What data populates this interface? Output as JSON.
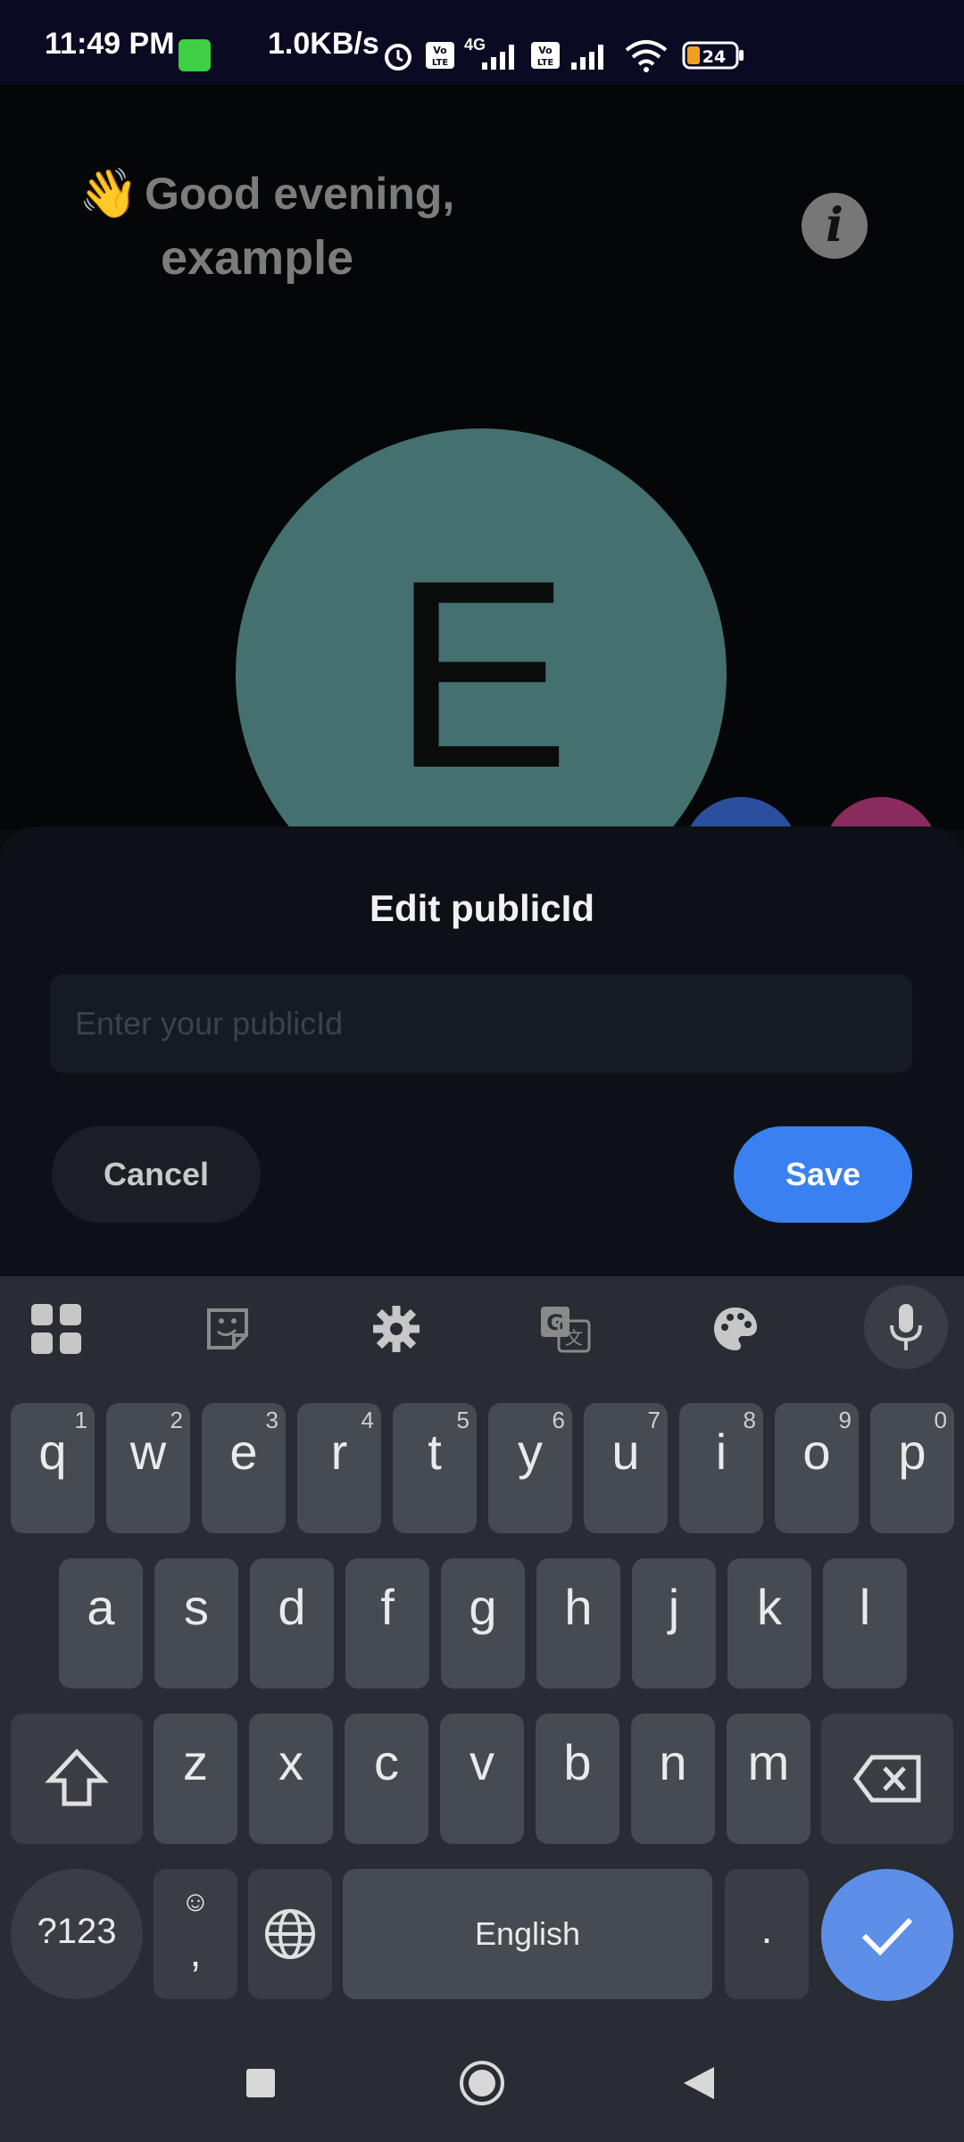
{
  "status_bar": {
    "time": "11:49 PM",
    "net_speed": "1.0KB/s",
    "network_type": "4G",
    "volte_label": "Vo LTE",
    "battery": "24",
    "icons": [
      "alarm-icon",
      "volte-icon",
      "signal-icon",
      "wifi-icon",
      "battery-icon"
    ]
  },
  "header": {
    "greeting_emoji": "👋",
    "greeting": "Good evening,",
    "username": "example",
    "info_icon": "i"
  },
  "avatar": {
    "initial": "E",
    "color": "#457070"
  },
  "sheet": {
    "title": "Edit publicId",
    "input_placeholder": "Enter your publicId",
    "input_value": "",
    "cancel_label": "Cancel",
    "save_label": "Save"
  },
  "keyboard": {
    "toolbar_icons": [
      "apps-grid-icon",
      "sticker-icon",
      "settings-gear-icon",
      "translate-icon",
      "palette-icon",
      "mic-icon"
    ],
    "row1": [
      {
        "k": "q",
        "n": "1"
      },
      {
        "k": "w",
        "n": "2"
      },
      {
        "k": "e",
        "n": "3"
      },
      {
        "k": "r",
        "n": "4"
      },
      {
        "k": "t",
        "n": "5"
      },
      {
        "k": "y",
        "n": "6"
      },
      {
        "k": "u",
        "n": "7"
      },
      {
        "k": "i",
        "n": "8"
      },
      {
        "k": "o",
        "n": "9"
      },
      {
        "k": "p",
        "n": "0"
      }
    ],
    "row2": [
      "a",
      "s",
      "d",
      "f",
      "g",
      "h",
      "j",
      "k",
      "l"
    ],
    "row3": [
      "z",
      "x",
      "c",
      "v",
      "b",
      "n",
      "m"
    ],
    "symbols_label": "?123",
    "comma_label": ",",
    "emoji_hint": "☺",
    "space_label": "English",
    "period_label": "."
  },
  "colors": {
    "accent": "#3a80f0",
    "sheet_bg": "#0d1117",
    "keyboard_bg": "#292c32"
  }
}
